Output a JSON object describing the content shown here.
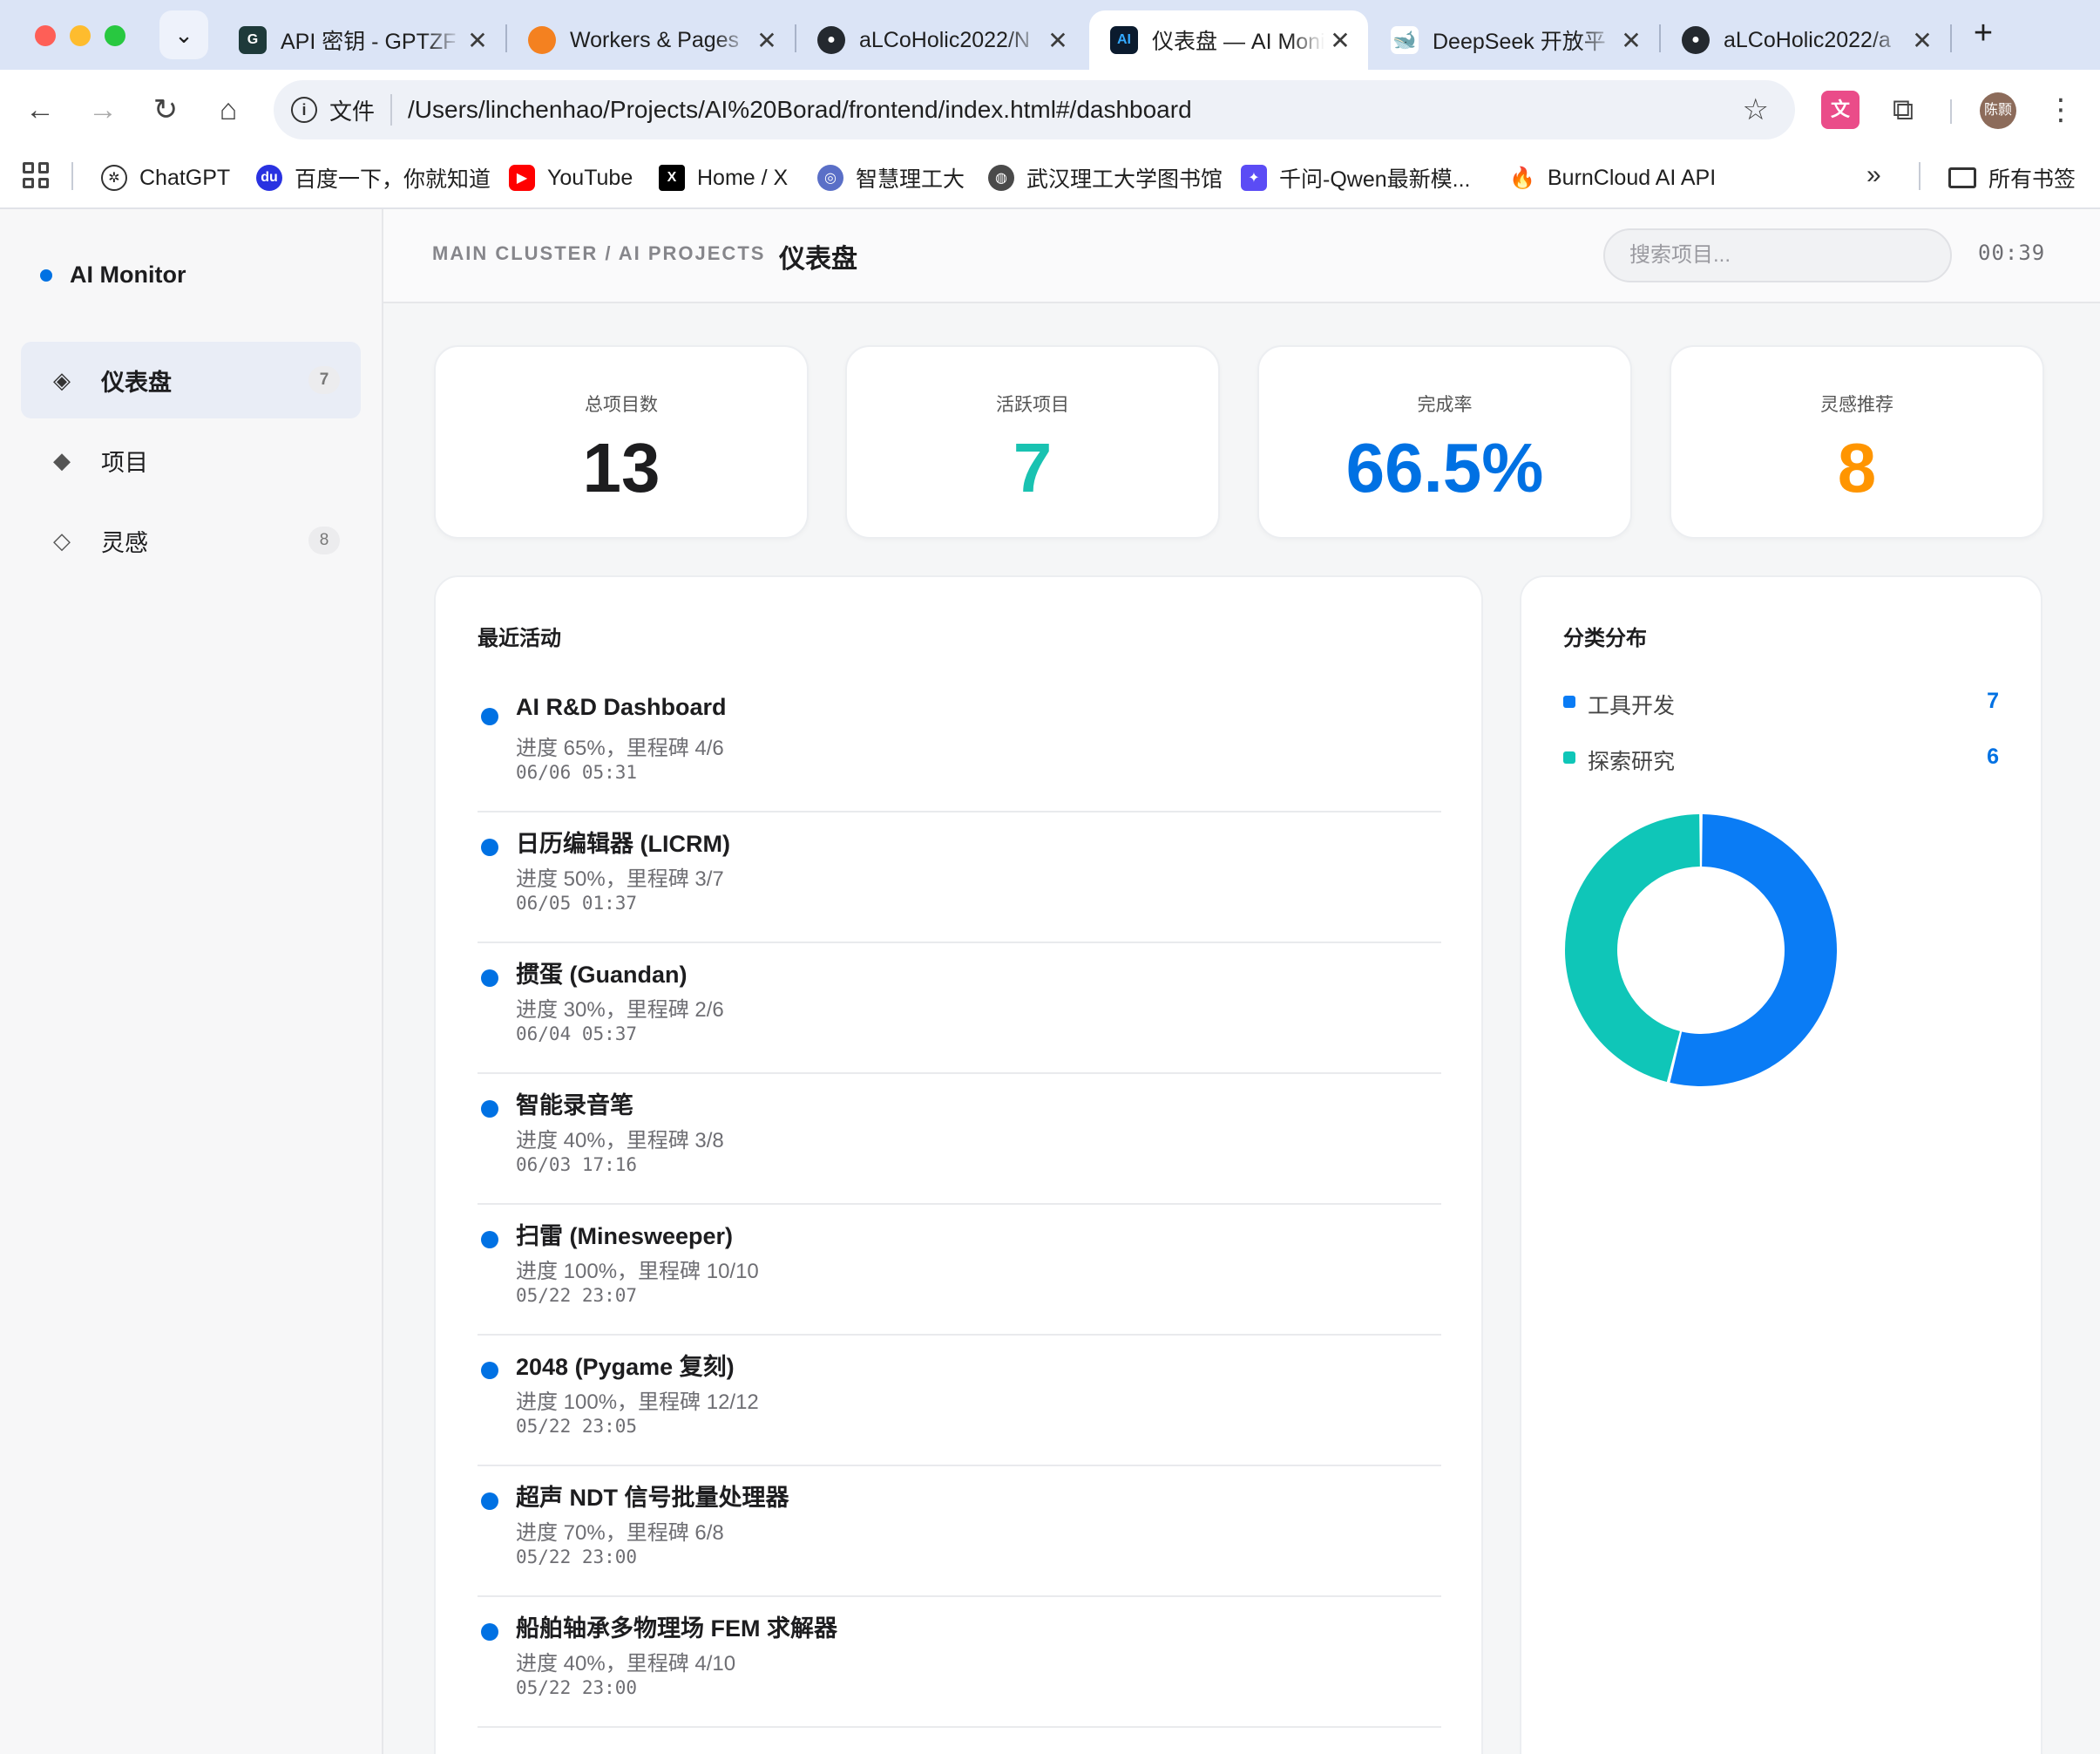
{
  "browser": {
    "tabs": [
      {
        "title": "API 密钥 - GPTZF",
        "icon": "gptz-icon",
        "active": false
      },
      {
        "title": "Workers & Pages",
        "icon": "cloudflare-icon",
        "active": false
      },
      {
        "title": "aLCoHolic2022/N",
        "icon": "github-icon",
        "active": false
      },
      {
        "title": "仪表盘 — AI Moni",
        "icon": "ai-icon",
        "active": true
      },
      {
        "title": "DeepSeek 开放平",
        "icon": "deepseek-icon",
        "active": false
      },
      {
        "title": "aLCoHolic2022/a",
        "icon": "github-icon",
        "active": false
      }
    ],
    "omnibox": {
      "scheme_label": "文件",
      "url": "/Users/linchenhao/Projects/AI%20Borad/frontend/index.html#/dashboard"
    },
    "profile_label": "陈颢",
    "bookmarks": [
      {
        "label": "ChatGPT"
      },
      {
        "label": "百度一下，你就知道"
      },
      {
        "label": "YouTube"
      },
      {
        "label": "Home / X"
      },
      {
        "label": "智慧理工大"
      },
      {
        "label": "武汉理工大学图书馆"
      },
      {
        "label": "千问-Qwen最新模..."
      },
      {
        "label": "BurnCloud AI API"
      }
    ],
    "all_bookmarks_label": "所有书签"
  },
  "sidebar": {
    "brand": "AI Monitor",
    "items": [
      {
        "label": "仪表盘",
        "icon": "diamond-dot-icon",
        "badge": "7",
        "active": true
      },
      {
        "label": "项目",
        "icon": "diamond-filled-icon",
        "badge": "",
        "active": false
      },
      {
        "label": "灵感",
        "icon": "diamond-outline-icon",
        "badge": "8",
        "active": false
      }
    ]
  },
  "header": {
    "breadcrumb": "MAIN CLUSTER / AI PROJECTS",
    "title": "仪表盘",
    "search_placeholder": "搜索项目...",
    "clock": "00:39"
  },
  "stats": [
    {
      "label": "总项目数",
      "value": "13",
      "color": "#1d1d1f"
    },
    {
      "label": "活跃项目",
      "value": "7",
      "color": "#19c2b1"
    },
    {
      "label": "完成率",
      "value": "66.5%",
      "color": "#0071e3"
    },
    {
      "label": "灵感推荐",
      "value": "8",
      "color": "#ff9500"
    }
  ],
  "activity": {
    "title": "最近活动",
    "items": [
      {
        "title": "AI R&D Dashboard",
        "sub": "进度 65%，里程碑 4/6",
        "time": "06/06 05:31"
      },
      {
        "title": "日历编辑器 (LICRM)",
        "sub": "进度 50%，里程碑 3/7",
        "time": "06/05 01:37"
      },
      {
        "title": "掼蛋 (Guandan)",
        "sub": "进度 30%，里程碑 2/6",
        "time": "06/04 05:37"
      },
      {
        "title": "智能录音笔",
        "sub": "进度 40%，里程碑 3/8",
        "time": "06/03 17:16"
      },
      {
        "title": "扫雷 (Minesweeper)",
        "sub": "进度 100%，里程碑 10/10",
        "time": "05/22 23:07"
      },
      {
        "title": "2048 (Pygame 复刻)",
        "sub": "进度 100%，里程碑 12/12",
        "time": "05/22 23:05"
      },
      {
        "title": "超声 NDT 信号批量处理器",
        "sub": "进度 70%，里程碑 6/8",
        "time": "05/22 23:00"
      },
      {
        "title": "船舶轴承多物理场 FEM 求解器",
        "sub": "进度 40%，里程碑 4/10",
        "time": "05/22 23:00"
      }
    ]
  },
  "distribution": {
    "title": "分类分布",
    "categories": [
      {
        "label": "工具开发",
        "value": 7,
        "color": "#0a7cf5"
      },
      {
        "label": "探索研究",
        "value": 6,
        "color": "#0fc6b8"
      }
    ]
  },
  "chart_data": {
    "type": "pie",
    "title": "分类分布",
    "categories": [
      "工具开发",
      "探索研究"
    ],
    "values": [
      7,
      6
    ],
    "donut": true,
    "legend": "top"
  }
}
